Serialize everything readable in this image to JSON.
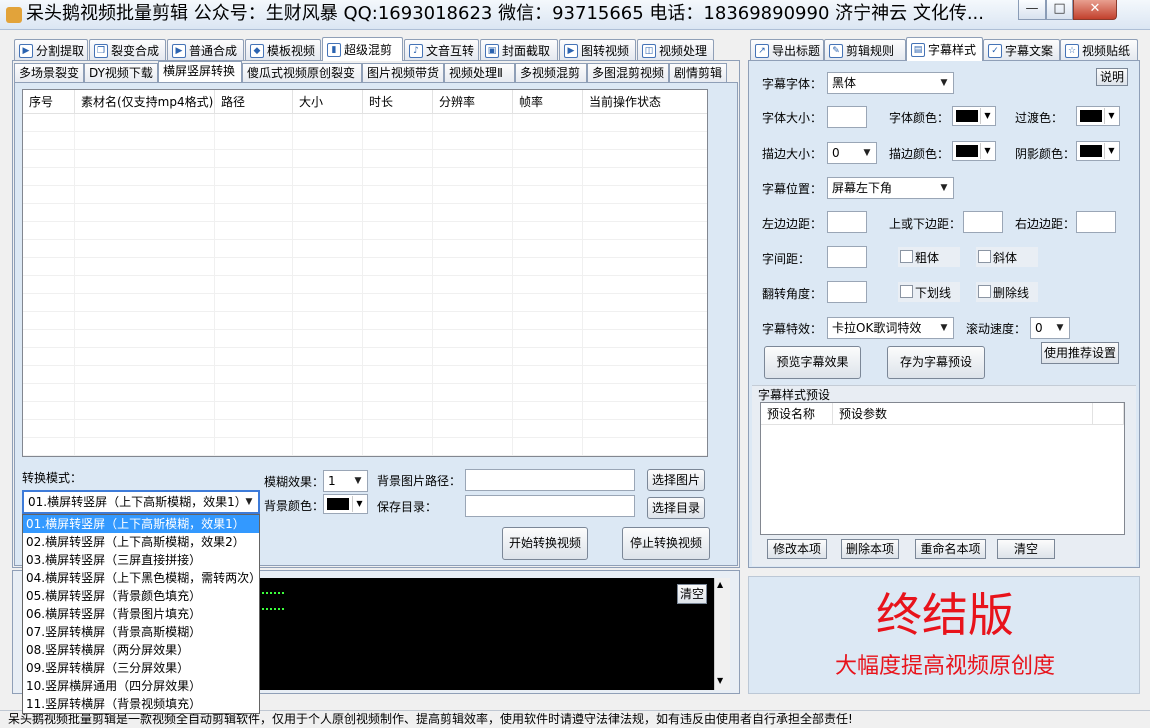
{
  "window": {
    "title": "呆头鹅视频批量剪辑 公众号：生财风暴 QQ:1693018623 微信：93715665 电话：18369890990 济宁神云 文化传...",
    "minimize": "—",
    "maximize": "□",
    "close": "✕"
  },
  "main_tabs": [
    {
      "label": "分割提取",
      "icon": "▶"
    },
    {
      "label": "裂变合成",
      "icon": "❐"
    },
    {
      "label": "普通合成",
      "icon": "▶"
    },
    {
      "label": "模板视频",
      "icon": "◆"
    },
    {
      "label": "超级混剪",
      "icon": "▮"
    },
    {
      "label": "文音互转",
      "icon": "♪"
    },
    {
      "label": "封面截取",
      "icon": "▣"
    },
    {
      "label": "图转视频",
      "icon": "▶"
    },
    {
      "label": "视频处理",
      "icon": "◫"
    }
  ],
  "sub_tabs": [
    "多场景裂变",
    "DY视频下载",
    "横屏竖屏转换",
    "傻瓜式视频原创裂变",
    "图片视频带货",
    "视频处理Ⅱ",
    "多视频混剪",
    "多图混剪视频",
    "剧情剪辑"
  ],
  "table": {
    "columns": [
      "序号",
      "素材名(仅支持mp4格式)",
      "路径",
      "大小",
      "时长",
      "分辨率",
      "帧率",
      "当前操作状态"
    ]
  },
  "convert": {
    "mode_label": "转换模式：",
    "mode_value": "01.横屏转竖屏（上下高斯模糊，效果1）",
    "options": [
      "01.横屏转竖屏（上下高斯模糊，效果1）",
      "02.横屏转竖屏（上下高斯模糊，效果2）",
      "03.横屏转竖屏（三屏直接拼接）",
      "04.横屏转竖屏（上下黑色模糊，需转两次）",
      "05.横屏转竖屏（背景颜色填充）",
      "06.横屏转竖屏（背景图片填充）",
      "07.竖屏转横屏（背景高斯模糊）",
      "08.竖屏转横屏（两分屏效果）",
      "09.竖屏转横屏（三分屏效果）",
      "10.竖屏横屏通用（四分屏效果）",
      "11.竖屏转横屏（背景视频填充）"
    ],
    "blur_label": "模糊效果：",
    "blur_value": "1",
    "bgcolor_label": "背景颜色：",
    "bgimg_label": "背景图片路径：",
    "bgimg_value": "",
    "save_label": "保存目录：",
    "save_value": "",
    "select_image": "选择图片",
    "select_dir": "选择目录",
    "start": "开始转换视频",
    "stop": "停止转换视频"
  },
  "log": {
    "clear": "清空"
  },
  "right_tabs": [
    {
      "label": "导出标题",
      "icon": "↗"
    },
    {
      "label": "剪辑规则",
      "icon": "✎"
    },
    {
      "label": "字幕样式",
      "icon": "▤"
    },
    {
      "label": "字幕文案",
      "icon": "✓"
    },
    {
      "label": "视频贴纸",
      "icon": "☆"
    }
  ],
  "subtitle": {
    "font_label": "字幕字体：",
    "font_value": "黑体",
    "help": "说明",
    "size_label": "字体大小：",
    "size_value": "",
    "color_label": "字体颜色：",
    "transition_label": "过渡色：",
    "stroke_size_label": "描边大小：",
    "stroke_size_value": "0",
    "stroke_color_label": "描边颜色：",
    "shadow_color_label": "阴影颜色：",
    "position_label": "字幕位置：",
    "position_value": "屏幕左下角",
    "left_margin_label": "左边边距：",
    "left_margin_value": "",
    "vmargin_label": "上或下边距：",
    "vmargin_value": "",
    "right_margin_label": "右边边距：",
    "right_margin_value": "",
    "spacing_label": "字间距：",
    "spacing_value": "",
    "bold": "粗体",
    "italic": "斜体",
    "angle_label": "翻转角度：",
    "angle_value": "",
    "underline": "下划线",
    "strike": "删除线",
    "effect_label": "字幕特效：",
    "effect_value": "卡拉OK歌词特效",
    "speed_label": "滚动速度：",
    "speed_value": "0",
    "preview": "预览字幕效果",
    "save_preset": "存为字幕预设",
    "recommend": "使用推荐设置",
    "presets_title": "字幕样式预设",
    "presets_columns": [
      "预设名称",
      "预设参数"
    ],
    "modify": "修改本项",
    "delete": "删除本项",
    "rename": "重命名本项",
    "clear": "清空"
  },
  "promo": {
    "title": "终结版",
    "subtitle": "大幅度提高视频原创度"
  },
  "statusbar": "呆头鹅视频批量剪辑是一款视频全自动剪辑软件，仅用于个人原创视频制作、提高剪辑效率，使用软件时请遵守法律法规，如有违反由使用者自行承担全部责任!",
  "colors": {
    "accent": "#3399ff",
    "promo_red": "#e8131b",
    "panel_blue": "#e3ecf6"
  }
}
